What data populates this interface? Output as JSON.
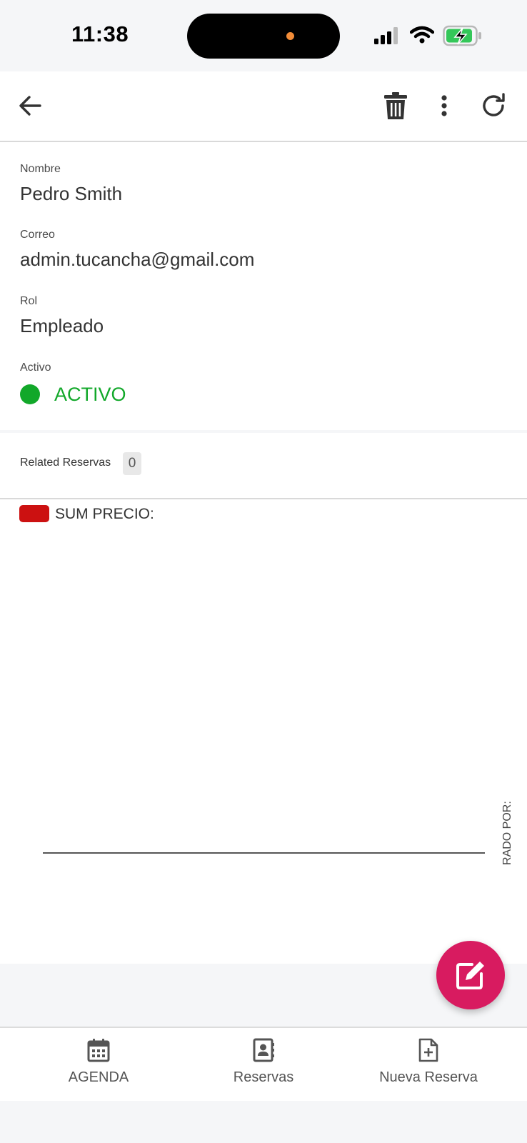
{
  "status_bar": {
    "time": "11:38",
    "icons": [
      "signal-icon",
      "wifi-icon",
      "battery-charging-icon"
    ]
  },
  "appbar": {
    "icons": [
      "back-arrow-icon",
      "trash-icon",
      "more-vertical-icon",
      "refresh-icon"
    ]
  },
  "record": {
    "fields": [
      {
        "label": "Nombre",
        "value": "Pedro Smith"
      },
      {
        "label": "Correo",
        "value": "admin.tucancha@gmail.com"
      },
      {
        "label": "Rol",
        "value": "Empleado"
      }
    ],
    "active": {
      "label": "Activo",
      "value": "ACTIVO",
      "color": "#12a82a"
    }
  },
  "related": {
    "label": "Related Reservas",
    "count": "0"
  },
  "chart_data": {
    "type": "bar",
    "series": [
      {
        "name": "SUM PRECIO:",
        "values": [],
        "color": "#cc1111"
      }
    ],
    "categories": [],
    "xlabel": "",
    "ylabel": "RADO POR:",
    "legend": "top-left",
    "grid": false
  },
  "fab": {
    "icon": "edit-icon",
    "color": "#d81b60"
  },
  "bottom_nav": {
    "items": [
      {
        "label": "AGENDA",
        "icon": "calendar-icon"
      },
      {
        "label": "Reservas",
        "icon": "contacts-book-icon"
      },
      {
        "label": "Nueva Reserva",
        "icon": "new-document-icon"
      }
    ]
  }
}
